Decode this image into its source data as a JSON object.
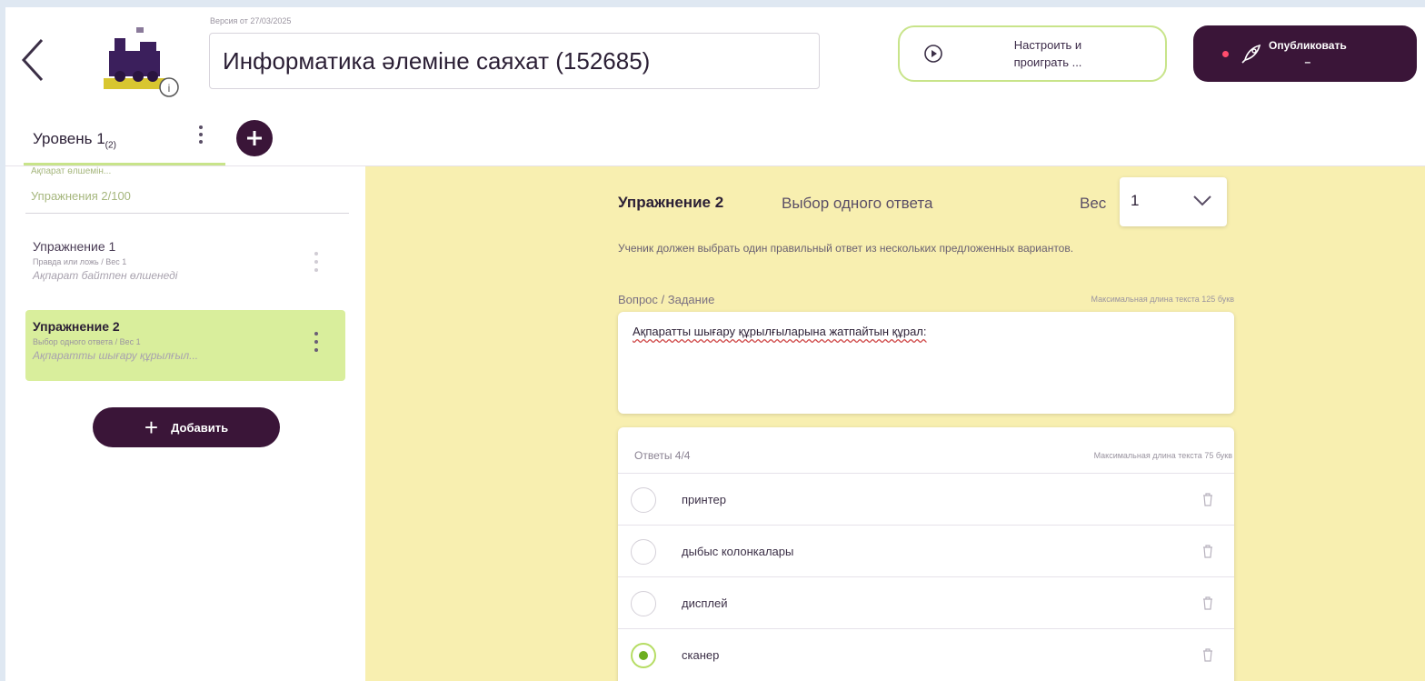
{
  "header": {
    "version_text": "Версия от 27/03/2025",
    "title": "Информатика әлеміне саяхат (152685)",
    "play_button_label": "Настроить и проиграть ...",
    "publish_button_label": "Опубликовать",
    "publish_button_sub": "–"
  },
  "tabs": {
    "level_label": "Уровень 1",
    "level_count": "(2)"
  },
  "sidebar": {
    "cut_text": "Ақпарат өлшемін...",
    "exercise_count": "Упражнения 2/100",
    "items": [
      {
        "title": "Упражнение 1",
        "meta": "Правда или ложь / Вес 1",
        "preview": "Ақпарат байтпен өлшенеді"
      },
      {
        "title": "Упражнение 2",
        "meta": "Выбор одного ответа / Вес 1",
        "preview": "Ақпаратты шығару құрылғыл..."
      }
    ],
    "add_button_label": "Добавить"
  },
  "editor": {
    "exercise_title": "Упражнение 2",
    "exercise_type": "Выбор одного ответа",
    "weight_label": "Вес",
    "weight_value": "1",
    "description": "Ученик должен выбрать один правильный ответ из нескольких предложенных вариантов.",
    "question_label": "Вопрос / Задание",
    "question_max": "Максимальная длина текста 125 букв",
    "question_text": "Ақпаратты шығару құрылғыларына жатпайтын құрал:",
    "answers_header": "Ответы 4/4",
    "answers_max": "Максимальная длина текста 75 букв",
    "answers": [
      {
        "text": "принтер",
        "selected": false
      },
      {
        "text": "дыбыс колонкалары",
        "selected": false
      },
      {
        "text": "дисплей",
        "selected": false
      },
      {
        "text": "сканер",
        "selected": true
      }
    ]
  },
  "colors": {
    "accent_dark": "#3a1538",
    "accent_green": "#c8e48a",
    "panel_yellow": "#f8efb0",
    "active_item": "#d9ee9c"
  }
}
